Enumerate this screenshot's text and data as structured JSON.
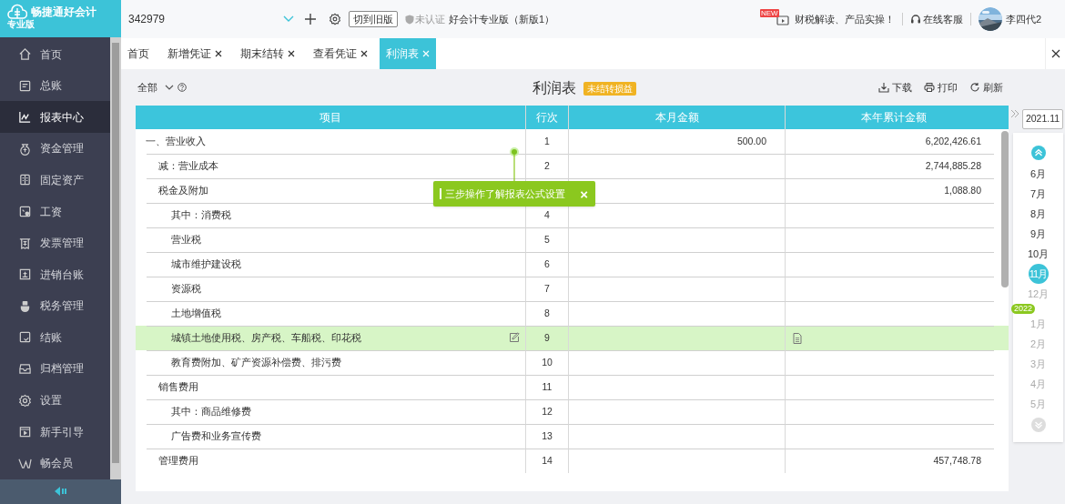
{
  "brand": {
    "name": "畅捷通好会计",
    "edition": "专业版"
  },
  "topbar": {
    "account": "342979",
    "old_version_button": "切到旧版",
    "cert_status": "未认证",
    "product": "好会计专业版（新版1）",
    "news_badge": "NEW",
    "news": "财税解读、产品实操！",
    "support": "在线客服",
    "user": "李四代2"
  },
  "sidebar": {
    "items": [
      {
        "label": "首页",
        "selected": false
      },
      {
        "label": "总账",
        "selected": false
      },
      {
        "label": "报表中心",
        "selected": true
      },
      {
        "label": "资金管理",
        "selected": false
      },
      {
        "label": "固定资产",
        "selected": false
      },
      {
        "label": "工资",
        "selected": false
      },
      {
        "label": "发票管理",
        "selected": false
      },
      {
        "label": "进销台账",
        "selected": false
      },
      {
        "label": "税务管理",
        "selected": false
      },
      {
        "label": "结账",
        "selected": false
      },
      {
        "label": "归档管理",
        "selected": false
      },
      {
        "label": "设置",
        "selected": false
      },
      {
        "label": "新手引导",
        "selected": false
      },
      {
        "label": "畅会员",
        "selected": false
      }
    ]
  },
  "tabs": [
    {
      "label": "首页",
      "closable": false,
      "selected": false
    },
    {
      "label": "新增凭证",
      "closable": true,
      "selected": false
    },
    {
      "label": "期末结转",
      "closable": true,
      "selected": false
    },
    {
      "label": "查看凭证",
      "closable": true,
      "selected": false
    },
    {
      "label": "利润表",
      "closable": true,
      "selected": true
    }
  ],
  "toolbar": {
    "filter": "全部",
    "title": "利润表",
    "status_badge": "未结转损益",
    "actions": [
      "下载",
      "打印",
      "刷新"
    ]
  },
  "table": {
    "columns": [
      "项目",
      "行次",
      "本月金额",
      "本年累计金额"
    ],
    "rows": [
      {
        "kind": "section",
        "item": "一、营业收入",
        "line": "1",
        "month": "500.00",
        "year": "6,202,426.61",
        "highlighted": false
      },
      {
        "kind": "item",
        "item": "减：营业成本",
        "line": "2",
        "month": "",
        "year": "2,744,885.28",
        "highlighted": false
      },
      {
        "kind": "item",
        "item": "税金及附加",
        "month": "",
        "year": "1,088.80",
        "highlighted": false
      },
      {
        "kind": "sub",
        "item": "其中：消费税",
        "line": "4",
        "month": "",
        "year": "",
        "highlighted": false
      },
      {
        "kind": "sub",
        "item": "营业税",
        "line": "5",
        "month": "",
        "year": "",
        "highlighted": false
      },
      {
        "kind": "sub",
        "item": "城市维护建设税",
        "line": "6",
        "month": "",
        "year": "",
        "highlighted": false
      },
      {
        "kind": "sub",
        "item": "资源税",
        "line": "7",
        "month": "",
        "year": "",
        "highlighted": false
      },
      {
        "kind": "sub",
        "item": "土地增值税",
        "line": "8",
        "month": "",
        "year": "",
        "highlighted": false
      },
      {
        "kind": "sub",
        "item": "城镇土地使用税、房产税、车船税、印花税",
        "line": "9",
        "month": "",
        "year": "",
        "highlighted": true
      },
      {
        "kind": "sub",
        "item": "教育费附加、矿产资源补偿费、排污费",
        "line": "10",
        "month": "",
        "year": "",
        "highlighted": false
      },
      {
        "kind": "item",
        "item": "销售费用",
        "line": "11",
        "month": "",
        "year": "",
        "highlighted": false
      },
      {
        "kind": "sub",
        "item": "其中：商品维修费",
        "line": "12",
        "month": "",
        "year": "",
        "highlighted": false
      },
      {
        "kind": "sub",
        "item": "广告费和业务宣传费",
        "line": "13",
        "month": "",
        "year": "",
        "highlighted": false
      },
      {
        "kind": "item",
        "item": "管理费用",
        "line": "14",
        "month": "",
        "year": "457,748.78",
        "highlighted": false
      }
    ]
  },
  "guide_tip": {
    "text": "三步操作了解报表公式设置",
    "close": "×"
  },
  "period": {
    "current": "2021.11",
    "year_badge": "2022",
    "months": [
      {
        "label": "6月",
        "selected": false,
        "disabled": false
      },
      {
        "label": "7月",
        "selected": false,
        "disabled": false
      },
      {
        "label": "8月",
        "selected": false,
        "disabled": false
      },
      {
        "label": "9月",
        "selected": false,
        "disabled": false
      },
      {
        "label": "10月",
        "selected": false,
        "disabled": false
      },
      {
        "label": "11月",
        "selected": true,
        "disabled": false
      },
      {
        "label": "12月",
        "selected": false,
        "disabled": true
      },
      {
        "label": "1月",
        "selected": false,
        "disabled": true
      },
      {
        "label": "2月",
        "selected": false,
        "disabled": true
      },
      {
        "label": "3月",
        "selected": false,
        "disabled": true
      },
      {
        "label": "4月",
        "selected": false,
        "disabled": true
      },
      {
        "label": "5月",
        "selected": false,
        "disabled": true
      }
    ]
  }
}
